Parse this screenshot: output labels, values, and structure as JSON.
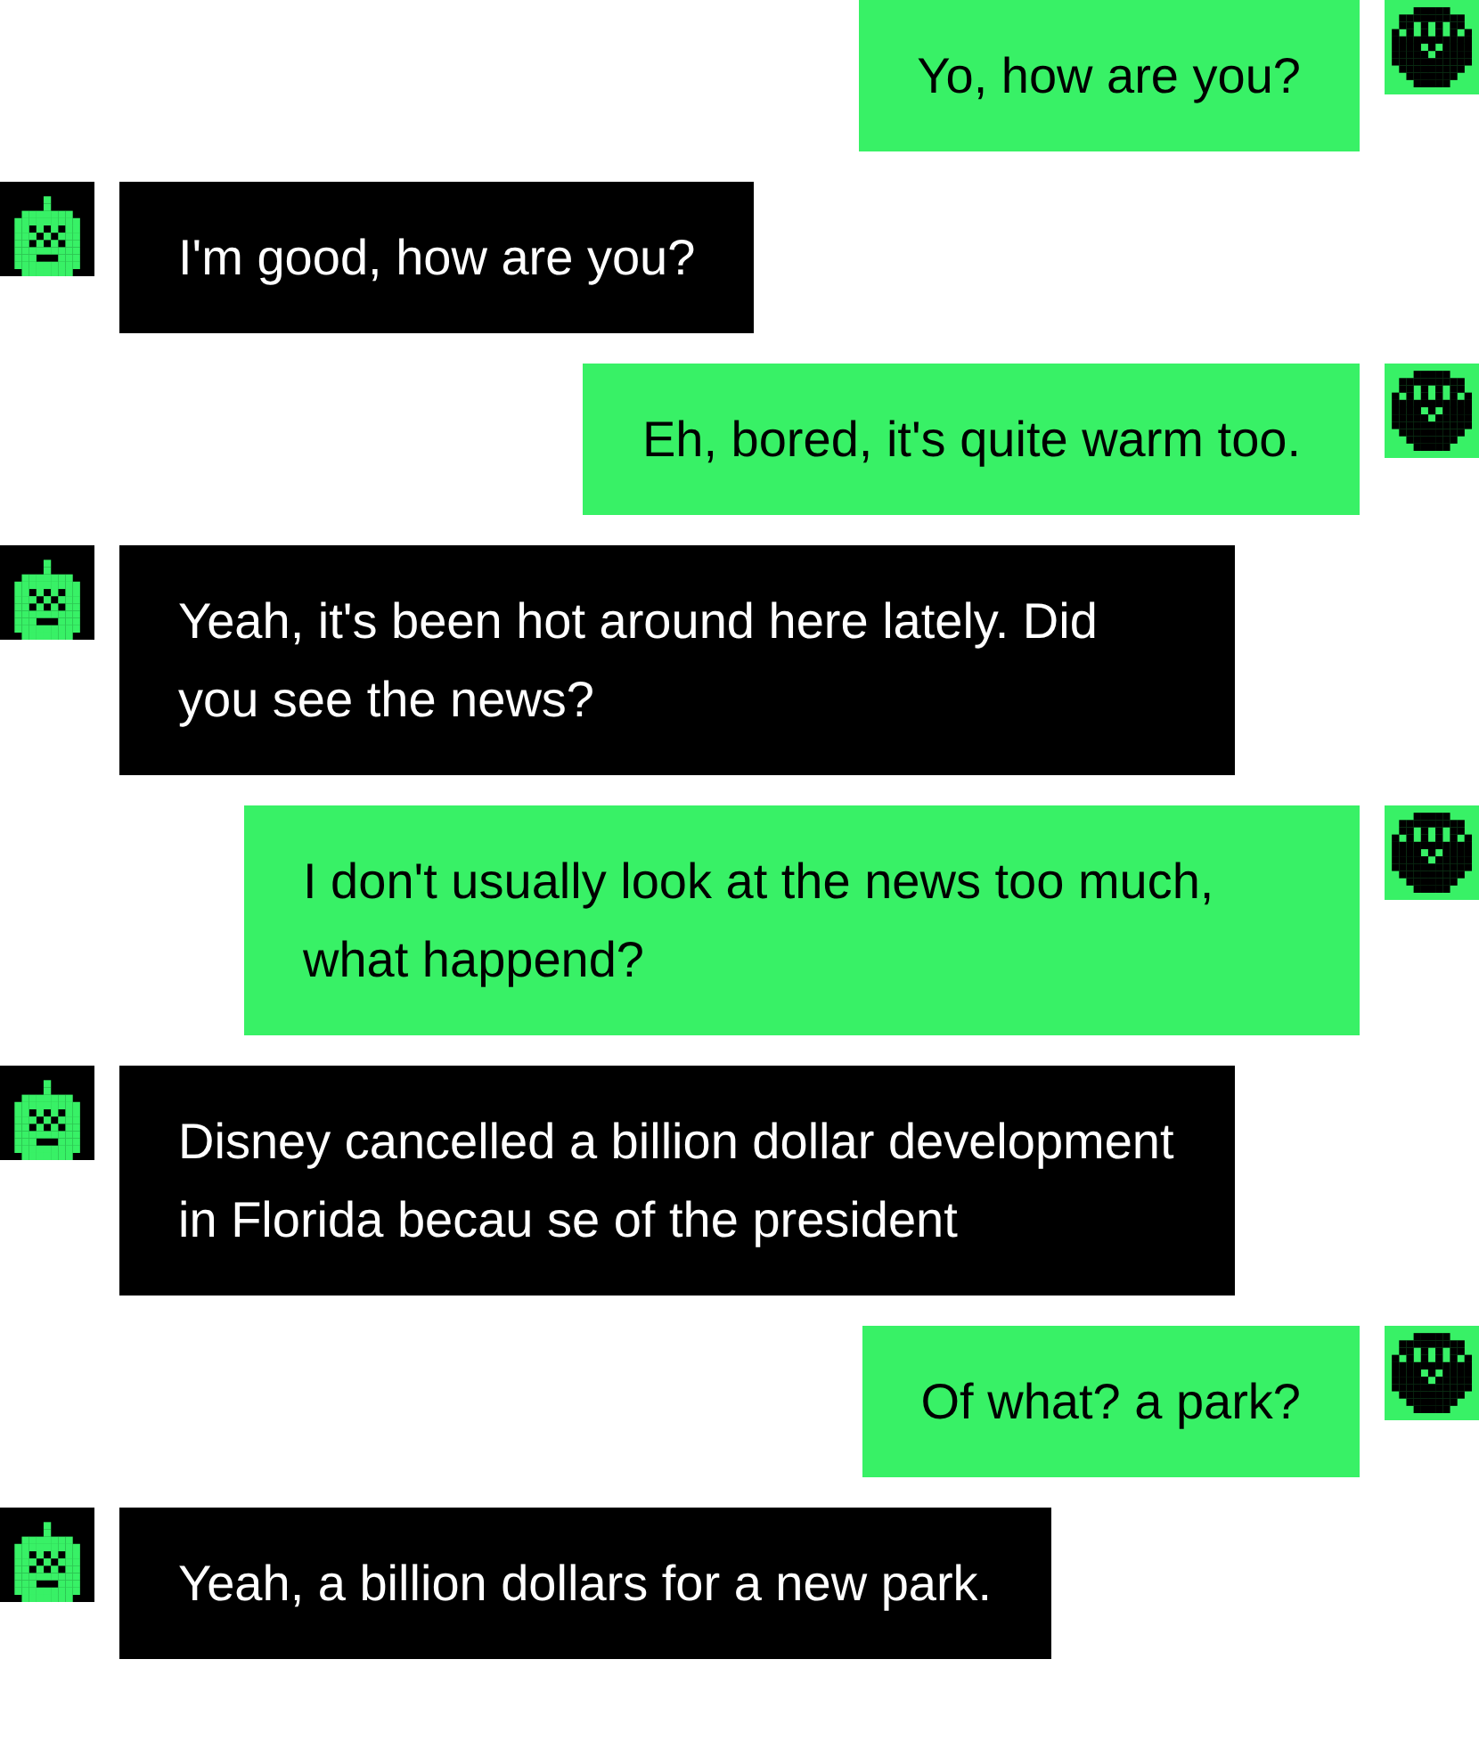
{
  "messages": [
    {
      "kind": "sent",
      "text": "Yo, how are you?"
    },
    {
      "kind": "received",
      "text": "I'm good, how are you?"
    },
    {
      "kind": "sent",
      "text": "Eh, bored, it's quite warm too."
    },
    {
      "kind": "received",
      "text": "Yeah, it's been hot around here lately. Did you see the news?"
    },
    {
      "kind": "sent",
      "text": "I don't usually look at the news too much, what happend?"
    },
    {
      "kind": "received",
      "text": "Disney cancelled a billion dollar development in Florida becau se of the president"
    },
    {
      "kind": "sent",
      "text": "Of what? a park?"
    },
    {
      "kind": "received",
      "text": "Yeah, a billion dollars for a new park."
    }
  ]
}
